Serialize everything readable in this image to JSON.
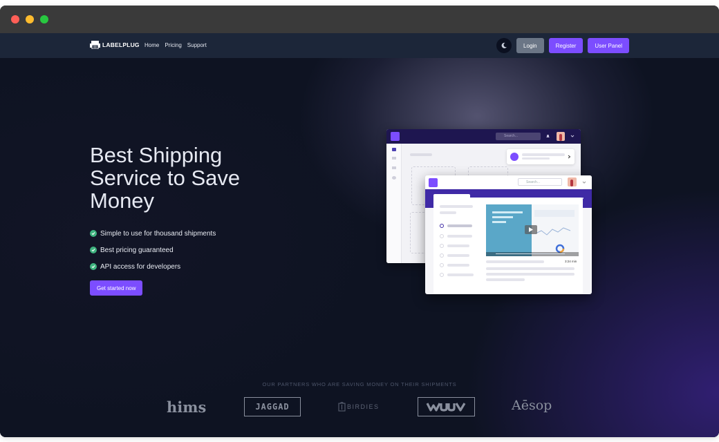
{
  "nav": {
    "brand": "LABELPLUG",
    "links": [
      "Home",
      "Pricing",
      "Support"
    ],
    "login_label": "Login",
    "register_label": "Register",
    "user_panel_label": "User Panel"
  },
  "hero": {
    "title_lines": [
      "Best Shipping",
      "Service to Save",
      "Money"
    ],
    "features": [
      "Simple to use for thousand shipments",
      "Best pricing guaranteed",
      "API access for developers"
    ],
    "cta_label": "Get started now"
  },
  "mockup": {
    "search_placeholder_back": "Search...",
    "search_placeholder_front": "Search...",
    "video_duration": "3:24 min"
  },
  "partners": {
    "heading": "OUR PARTNERS WHO ARE SAVING MONEY ON THEIR SHIPMENTS",
    "logos": [
      "hims",
      "JAGGAD",
      "BIRDIES",
      "Aēsop"
    ]
  },
  "colors": {
    "accent": "#7c4dff",
    "navbar": "#1c2639",
    "check": "#3fb37f",
    "background": "#0f1425"
  },
  "icons": {
    "theme_toggle": "moon-icon",
    "feature_bullet": "check-circle-icon"
  }
}
